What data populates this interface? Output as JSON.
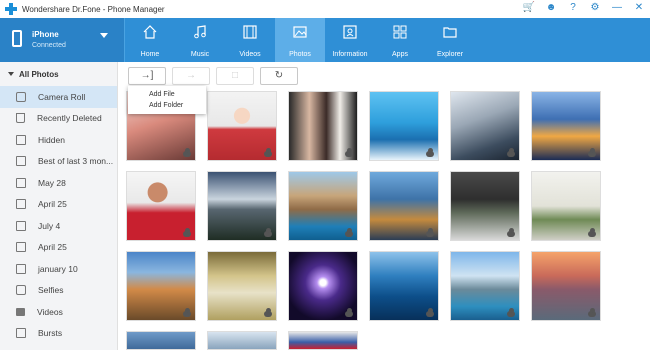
{
  "app": {
    "title": "Wondershare Dr.Fone - Phone Manager"
  },
  "device": {
    "name": "iPhone",
    "status": "Connected"
  },
  "nav": [
    {
      "label": "Home",
      "icon": "home-icon"
    },
    {
      "label": "Music",
      "icon": "music-icon"
    },
    {
      "label": "Videos",
      "icon": "video-icon"
    },
    {
      "label": "Photos",
      "icon": "photo-icon",
      "active": true
    },
    {
      "label": "Information",
      "icon": "contact-card-icon"
    },
    {
      "label": "Apps",
      "icon": "apps-grid-icon"
    },
    {
      "label": "Explorer",
      "icon": "folder-icon"
    }
  ],
  "sidebar": {
    "header": "All Photos",
    "items": [
      {
        "label": "Camera Roll",
        "icon": "camera-icon",
        "active": true
      },
      {
        "label": "Recently Deleted",
        "icon": "trash-icon"
      },
      {
        "label": "Hidden",
        "icon": "album-icon"
      },
      {
        "label": "Best of last 3 mon...",
        "icon": "album-icon"
      },
      {
        "label": "May 28",
        "icon": "album-icon"
      },
      {
        "label": "April 25",
        "icon": "album-icon"
      },
      {
        "label": "July 4",
        "icon": "album-icon"
      },
      {
        "label": "April 25",
        "icon": "album-icon"
      },
      {
        "label": "january 10",
        "icon": "album-icon"
      },
      {
        "label": "Selfies",
        "icon": "camera-icon"
      },
      {
        "label": "Videos",
        "icon": "video-icon"
      },
      {
        "label": "Bursts",
        "icon": "album-icon"
      }
    ]
  },
  "toolbar": {
    "add_icon": "→]",
    "export_icon": "→",
    "delete_icon": "□",
    "refresh_icon": "↻"
  },
  "dropdown": {
    "items": [
      "Add File",
      "Add Folder"
    ]
  },
  "colors": {
    "accent": "#2f8fd6",
    "active_nav": "#5daee8",
    "sidebar_active": "#d4e6f6"
  }
}
